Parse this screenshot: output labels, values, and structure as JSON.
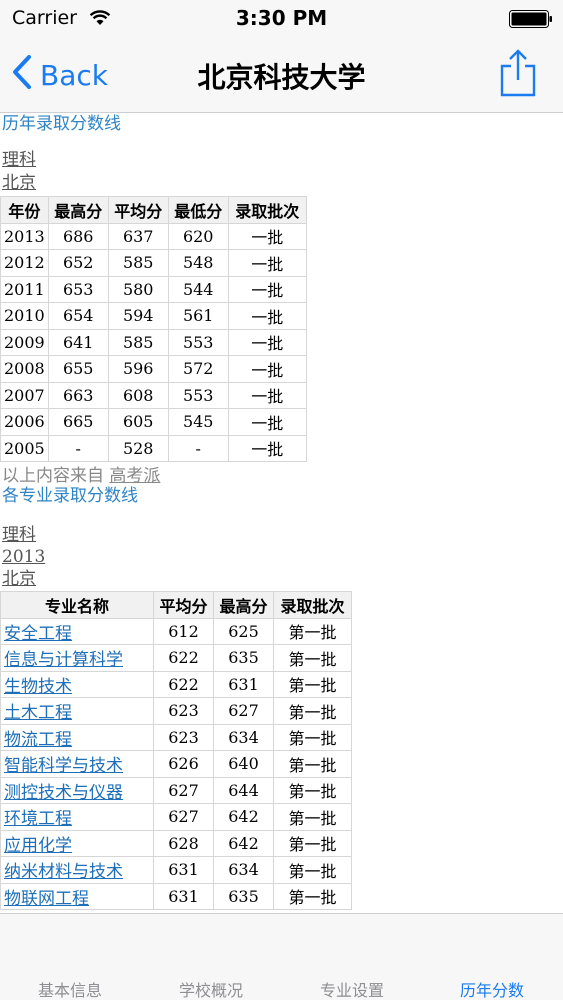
{
  "status": {
    "carrier": "Carrier",
    "time": "3:30 PM"
  },
  "nav": {
    "back_label": "Back",
    "title": "北京科技大学"
  },
  "section1": {
    "title": "历年录取分数线",
    "subject": "理科",
    "region": "北京",
    "headers": [
      "年份",
      "最高分",
      "平均分",
      "最低分",
      "录取批次"
    ],
    "rows": [
      [
        "2013",
        "686",
        "637",
        "620",
        "一批"
      ],
      [
        "2012",
        "652",
        "585",
        "548",
        "一批"
      ],
      [
        "2011",
        "653",
        "580",
        "544",
        "一批"
      ],
      [
        "2010",
        "654",
        "594",
        "561",
        "一批"
      ],
      [
        "2009",
        "641",
        "585",
        "553",
        "一批"
      ],
      [
        "2008",
        "655",
        "596",
        "572",
        "一批"
      ],
      [
        "2007",
        "663",
        "608",
        "553",
        "一批"
      ],
      [
        "2006",
        "665",
        "605",
        "545",
        "一批"
      ],
      [
        "2005",
        "-",
        "528",
        "-",
        "一批"
      ]
    ],
    "source_prefix": "以上内容来自",
    "source_link": "高考派"
  },
  "section2": {
    "title": "各专业录取分数线",
    "subject": "理科",
    "year": "2013",
    "region": "北京",
    "headers": [
      "专业名称",
      "平均分",
      "最高分",
      "录取批次"
    ],
    "rows": [
      [
        "安全工程",
        "612",
        "625",
        "第一批"
      ],
      [
        "信息与计算科学",
        "622",
        "635",
        "第一批"
      ],
      [
        "生物技术",
        "622",
        "631",
        "第一批"
      ],
      [
        "土木工程",
        "623",
        "627",
        "第一批"
      ],
      [
        "物流工程",
        "623",
        "634",
        "第一批"
      ],
      [
        "智能科学与技术",
        "626",
        "640",
        "第一批"
      ],
      [
        "测控技术与仪器",
        "627",
        "644",
        "第一批"
      ],
      [
        "环境工程",
        "627",
        "642",
        "第一批"
      ],
      [
        "应用化学",
        "628",
        "642",
        "第一批"
      ],
      [
        "纳米材料与技术",
        "631",
        "634",
        "第一批"
      ],
      [
        "物联网工程",
        "631",
        "635",
        "第一批"
      ]
    ]
  },
  "tabs": [
    {
      "label": "基本信息",
      "active": false
    },
    {
      "label": "学校概况",
      "active": false
    },
    {
      "label": "专业设置",
      "active": false
    },
    {
      "label": "历年分数",
      "active": true
    }
  ],
  "colors": {
    "accent": "#1a7cf0",
    "link": "#2f84c6",
    "inactive_tab": "#8e8e93"
  }
}
